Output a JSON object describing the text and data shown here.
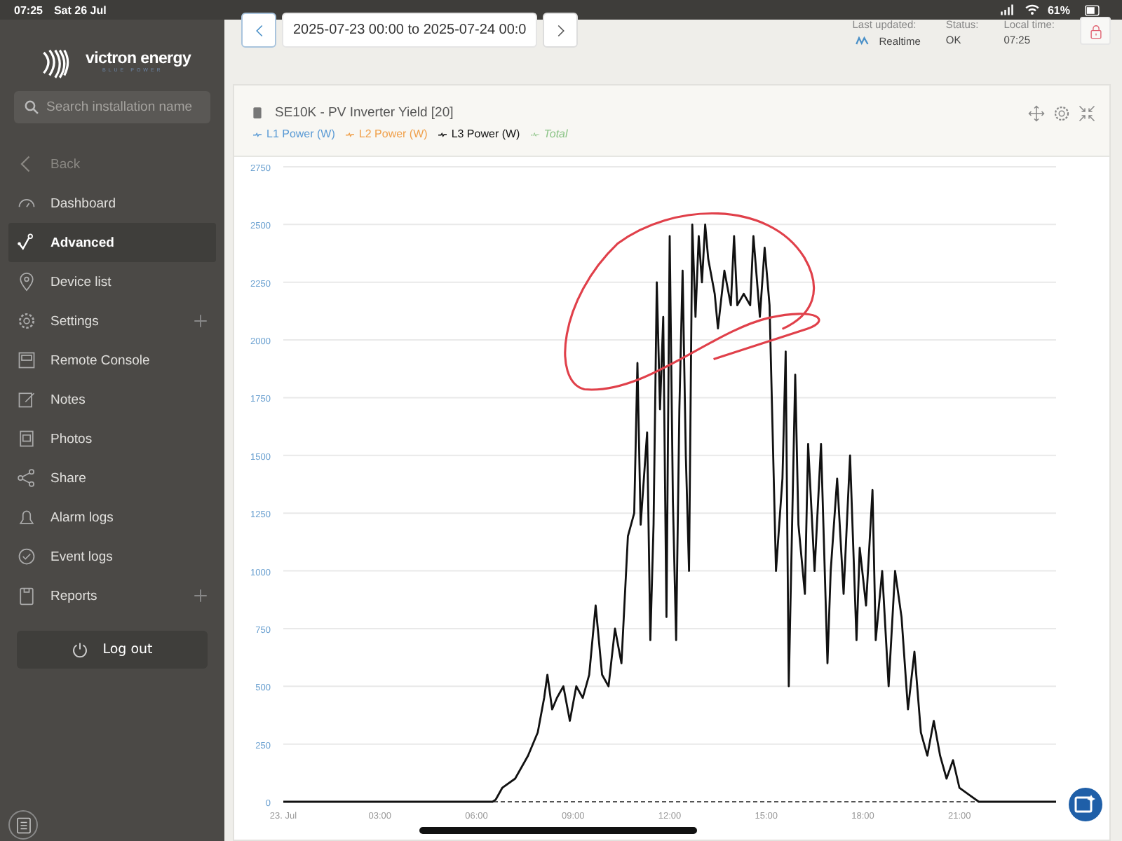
{
  "status_bar": {
    "time": "07:25",
    "date": "Sat 26 Jul",
    "battery": "61%"
  },
  "sidebar": {
    "logo": "victron energy",
    "logo_tagline": "BLUE POWER",
    "search": {
      "placeholder": "Search installation name"
    },
    "items": [
      {
        "label": "Back",
        "kind": "back",
        "selected": false,
        "expandable": false
      },
      {
        "label": "Dashboard",
        "kind": "dashboard",
        "selected": false,
        "expandable": false
      },
      {
        "label": "Advanced",
        "kind": "advanced",
        "selected": true,
        "expandable": false
      },
      {
        "label": "Device list",
        "kind": "pin",
        "selected": false,
        "expandable": false
      },
      {
        "label": "Settings",
        "kind": "gear",
        "selected": false,
        "expandable": true
      },
      {
        "label": "Remote Console",
        "kind": "console",
        "selected": false,
        "expandable": false
      },
      {
        "label": "Notes",
        "kind": "notes",
        "selected": false,
        "expandable": false
      },
      {
        "label": "Photos",
        "kind": "photo",
        "selected": false,
        "expandable": false
      },
      {
        "label": "Share",
        "kind": "share",
        "selected": false,
        "expandable": false
      },
      {
        "label": "Alarm logs",
        "kind": "alarm",
        "selected": false,
        "expandable": false
      },
      {
        "label": "Event logs",
        "kind": "event",
        "selected": false,
        "expandable": false
      },
      {
        "label": "Reports",
        "kind": "report",
        "selected": false,
        "expandable": true
      }
    ],
    "logout": "Log out"
  },
  "toolbar": {
    "date_range": "2025-07-23 00:00 to 2025-07-24 00:0",
    "status": [
      {
        "label": "Last updated:",
        "value": "Realtime"
      },
      {
        "label": "Status:",
        "value": "OK"
      },
      {
        "label": "Local time:",
        "value": "07:25"
      }
    ]
  },
  "chart_card": {
    "title": "SE10K - PV Inverter Yield [20]",
    "legend": [
      {
        "kind": "label",
        "label": "L1 Power (W)",
        "color": "#5b9bd5",
        "enabled": true
      },
      {
        "kind": "label",
        "label": "L2 Power (W)",
        "color": "#f0a04b",
        "enabled": true
      },
      {
        "kind": "series",
        "enabled": true
      },
      {
        "kind": "label",
        "label": "Total",
        "color": "#8cc487",
        "enabled": false
      }
    ],
    "chart_data": {
      "type": "line",
      "grid": true,
      "xlim": [
        0,
        24
      ],
      "ylim": [
        0,
        2750
      ],
      "xticks": [
        {
          "value": 0,
          "label": "23. Jul"
        },
        {
          "value": 3,
          "label": "03:00"
        },
        {
          "value": 6,
          "label": "06:00"
        },
        {
          "value": 9,
          "label": "09:00"
        },
        {
          "value": 12,
          "label": "12:00"
        },
        {
          "value": 15,
          "label": "15:00"
        },
        {
          "value": 18,
          "label": "18:00"
        },
        {
          "value": 21,
          "label": "21:00"
        }
      ],
      "yticks": [
        0,
        250,
        500,
        750,
        1000,
        1250,
        1500,
        1750,
        2000,
        2250,
        2500,
        2750
      ],
      "x": [
        0,
        6.5,
        6.6,
        6.8,
        7.2,
        7.6,
        7.9,
        8.1,
        8.2,
        8.35,
        8.5,
        8.7,
        8.9,
        9.1,
        9.3,
        9.5,
        9.7,
        9.9,
        10.1,
        10.3,
        10.5,
        10.7,
        10.9,
        11.0,
        11.1,
        11.3,
        11.4,
        11.5,
        11.6,
        11.7,
        11.8,
        11.9,
        12.0,
        12.1,
        12.2,
        12.3,
        12.4,
        12.5,
        12.6,
        12.7,
        12.8,
        12.9,
        13.0,
        13.1,
        13.2,
        13.4,
        13.5,
        13.7,
        13.9,
        14.0,
        14.1,
        14.3,
        14.5,
        14.6,
        14.8,
        14.95,
        15.1,
        15.3,
        15.5,
        15.6,
        15.7,
        15.9,
        16.0,
        16.2,
        16.3,
        16.5,
        16.7,
        16.9,
        17.0,
        17.2,
        17.4,
        17.6,
        17.8,
        17.9,
        18.1,
        18.3,
        18.4,
        18.6,
        18.8,
        19.0,
        19.2,
        19.4,
        19.6,
        19.8,
        20.0,
        20.2,
        20.4,
        20.6,
        20.8,
        21.0,
        21.3,
        21.6,
        24
      ],
      "series": [
        {
          "name": "L3 Power (W)",
          "color": "#111111",
          "values": [
            0,
            0,
            10,
            60,
            100,
            200,
            300,
            450,
            550,
            400,
            450,
            500,
            350,
            500,
            450,
            550,
            850,
            550,
            500,
            750,
            600,
            1150,
            1250,
            1900,
            1200,
            1600,
            700,
            1200,
            2250,
            1700,
            2100,
            800,
            2450,
            1300,
            700,
            1700,
            2300,
            1500,
            1000,
            2500,
            2100,
            2450,
            2250,
            2500,
            2350,
            2200,
            2050,
            2300,
            2150,
            2450,
            2150,
            2200,
            2150,
            2450,
            2100,
            2400,
            2150,
            1000,
            1400,
            1950,
            500,
            1850,
            1200,
            900,
            1550,
            1000,
            1550,
            600,
            1000,
            1400,
            900,
            1500,
            700,
            1100,
            850,
            1350,
            700,
            1000,
            500,
            1000,
            800,
            400,
            650,
            300,
            200,
            350,
            200,
            100,
            180,
            60,
            30,
            0,
            0
          ]
        }
      ]
    }
  }
}
